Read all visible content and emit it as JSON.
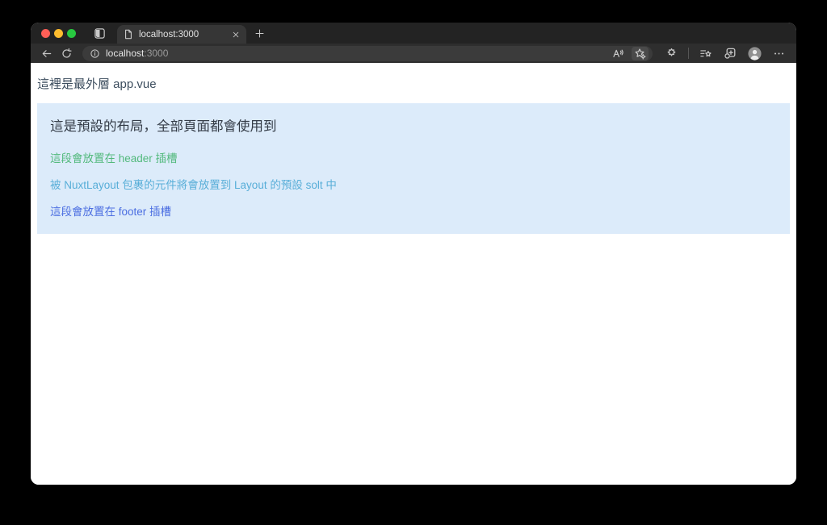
{
  "browser": {
    "traffic_lights": {
      "close": "#ff5f57",
      "minimize": "#febc2e",
      "zoom": "#28c840"
    },
    "tab": {
      "label": "localhost:3000"
    },
    "address_bar": {
      "host": "localhost",
      "port": ":3000"
    },
    "chrome_colors": {
      "tabstrip": "#232323",
      "active_tab": "#363636",
      "toolbar": "#2e2e2e",
      "omnibox": "#3b3b3b"
    },
    "icons": [
      "tab-actions",
      "page",
      "close-tab",
      "new-tab",
      "back",
      "reload",
      "site-info",
      "read-aloud",
      "favorites-settings",
      "extensions",
      "favorites",
      "collections",
      "profile-avatar",
      "more-menu"
    ]
  },
  "page": {
    "heading": "這裡是最外層 app.vue",
    "layout_box": {
      "title": "這是預設的布局，全部頁面都會使用到",
      "header_slot_text": "這段會放置在 header 插槽",
      "default_slot_text": "被 NuxtLayout 包裹的元件將會放置到 Layout 的預設 solt 中",
      "footer_slot_text": "這段會放置在 footer 插槽",
      "colors": {
        "background": "#dcebfa",
        "title": "#333b46",
        "header_slot": "#52b97c",
        "default_slot": "#58aed8",
        "footer_slot": "#4b6ee1"
      }
    }
  }
}
